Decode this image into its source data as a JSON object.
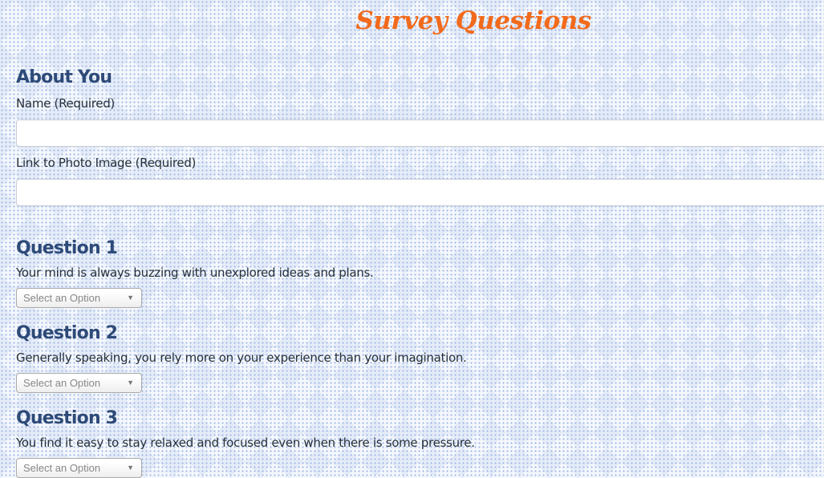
{
  "page": {
    "title": "Survey Questions"
  },
  "about": {
    "heading": "About You",
    "name_label": "Name (Required)",
    "name_value": "",
    "photo_label": "Link to Photo Image (Required)",
    "photo_value": ""
  },
  "questions": [
    {
      "heading": "Question 1",
      "text": "Your mind is always buzzing with unexplored ideas and plans.",
      "selected": "Select an Option"
    },
    {
      "heading": "Question 2",
      "text": "Generally speaking, you rely more on your experience than your imagination.",
      "selected": "Select an Option"
    },
    {
      "heading": "Question 3",
      "text": "You find it easy to stay relaxed and focused even when there is some pressure.",
      "selected": "Select an Option"
    }
  ],
  "icons": {
    "select_arrow": "chevron-down-icon"
  },
  "colors": {
    "title": "#f26a1b",
    "heading": "#2d4a78",
    "background": "#f4f7fc"
  }
}
